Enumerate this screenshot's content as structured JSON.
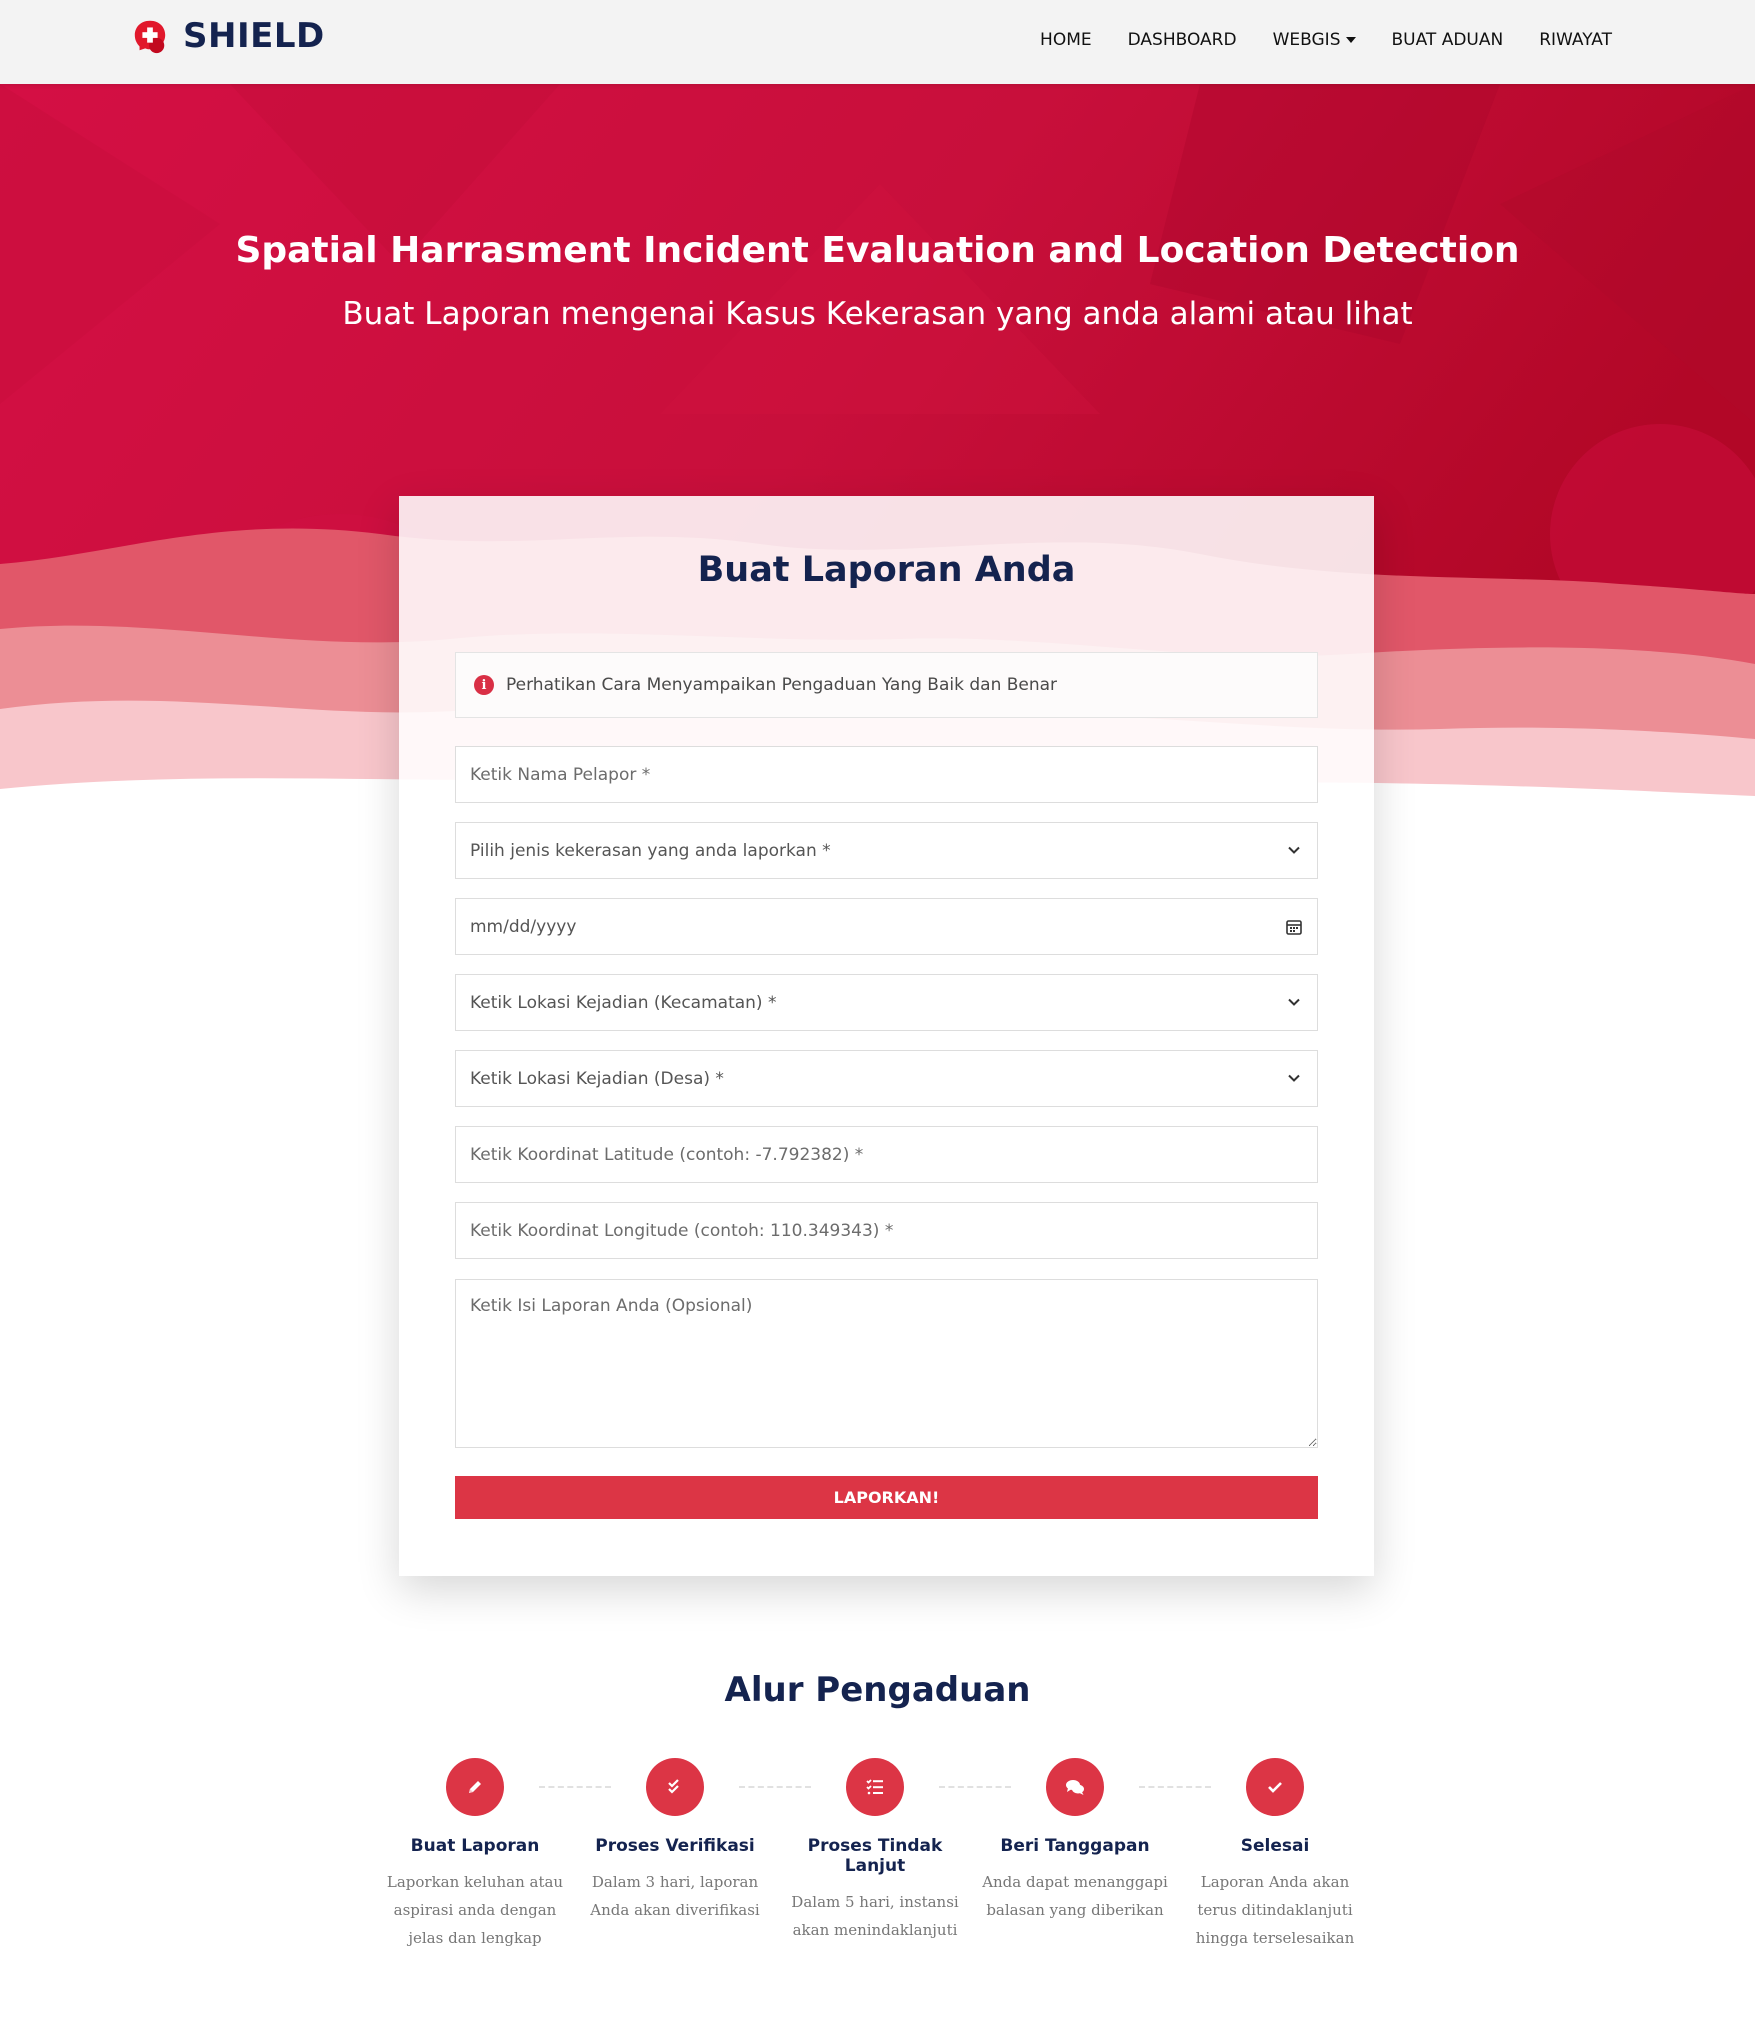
{
  "navbar": {
    "brand": "SHIELD",
    "items": [
      {
        "label": "HOME"
      },
      {
        "label": "DASHBOARD"
      },
      {
        "label": "WEBGIS"
      },
      {
        "label": "BUAT ADUAN"
      },
      {
        "label": "RIWAYAT"
      }
    ]
  },
  "hero": {
    "title": "Spatial Harrasment Incident Evaluation and Location Detection",
    "subtitle": "Buat Laporan mengenai Kasus Kekerasan yang anda alami atau lihat"
  },
  "form": {
    "title": "Buat Laporan Anda",
    "notice": "Perhatikan Cara Menyampaikan Pengaduan Yang Baik dan Benar",
    "nama_placeholder": "Ketik Nama Pelapor *",
    "jenis_select": "Pilih jenis kekerasan yang anda laporkan *",
    "date_placeholder": "mm/dd/yyyy",
    "kecamatan_select": "Ketik Lokasi Kejadian (Kecamatan) *",
    "desa_select": "Ketik Lokasi Kejadian (Desa) *",
    "latitude_placeholder": "Ketik Koordinat Latitude (contoh: -7.792382) *",
    "longitude_placeholder": "Ketik Koordinat Longitude (contoh: 110.349343) *",
    "isi_placeholder": "Ketik Isi Laporan Anda (Opsional)",
    "submit_label": "LAPORKAN!"
  },
  "flow": {
    "title": "Alur Pengaduan",
    "steps": [
      {
        "name": "Buat Laporan",
        "desc": "Laporkan keluhan atau aspirasi anda dengan jelas dan lengkap",
        "icon": "pencil-icon"
      },
      {
        "name": "Proses Verifikasi",
        "desc": "Dalam 3 hari, laporan Anda akan diverifikasi",
        "icon": "double-check-icon"
      },
      {
        "name": "Proses Tindak Lanjut",
        "desc": "Dalam 5 hari, instansi akan menindaklanjuti",
        "icon": "checklist-icon"
      },
      {
        "name": "Beri Tanggapan",
        "desc": "Anda dapat menanggapi balasan yang diberikan",
        "icon": "comments-icon"
      },
      {
        "name": "Selesai",
        "desc": "Laporan Anda akan terus ditindaklanjuti hingga terselesaikan",
        "icon": "check-icon"
      }
    ]
  },
  "colors": {
    "primary": "#dc3545",
    "navy": "#14234f",
    "hero_dark": "#b5082a",
    "hero_light": "#d4103f"
  }
}
